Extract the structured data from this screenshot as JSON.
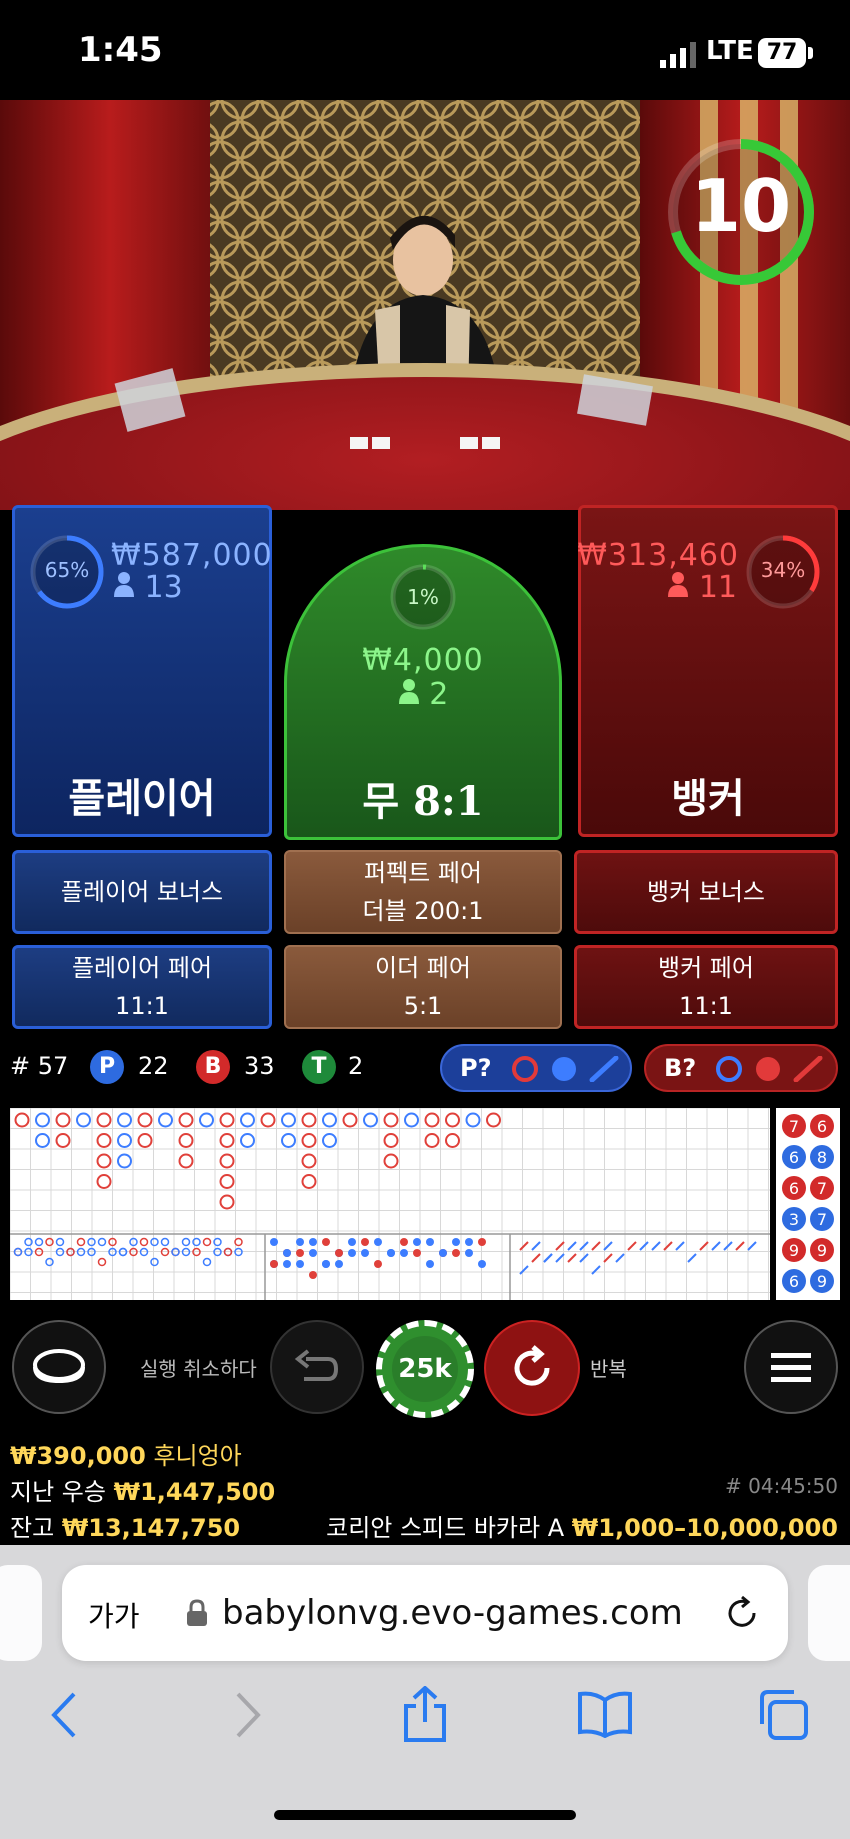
{
  "status_bar": {
    "time": "1:45",
    "network": "LTE",
    "battery": "77"
  },
  "video": {
    "timer": "10",
    "timer_color": "#37c837"
  },
  "player": {
    "percent": "65%",
    "amount": "₩587,000",
    "players": "13",
    "label": "플레이어",
    "color": "#2a5fd8"
  },
  "tie": {
    "percent": "1%",
    "amount": "₩4,000",
    "players": "2",
    "label": "무",
    "payout": "8:1",
    "color": "#3cc23a"
  },
  "banker": {
    "percent": "34%",
    "amount": "₩313,460",
    "players": "11",
    "label": "뱅커",
    "color": "#c02424"
  },
  "side_bets": {
    "player_bonus": "플레이어 보너스",
    "perfect_pair_line1": "퍼펙트 페어",
    "perfect_pair_line2": "더블 200:1",
    "banker_bonus": "뱅커 보너스",
    "player_pair_label": "플레이어 페어",
    "player_pair_payout": "11:1",
    "either_pair_label": "이더 페어",
    "either_pair_payout": "5:1",
    "banker_pair_label": "뱅커 페어",
    "banker_pair_payout": "11:1"
  },
  "stats": {
    "round": "# 57",
    "p_letter": "P",
    "p_count": "22",
    "b_letter": "B",
    "b_count": "33",
    "t_letter": "T",
    "t_count": "2",
    "p_predict": "P?",
    "b_predict": "B?"
  },
  "road_side": {
    "left": [
      "7",
      "6",
      "6",
      "3",
      "9",
      "6"
    ],
    "right": [
      "6",
      "8",
      "7",
      "7",
      "9",
      "9"
    ]
  },
  "controls": {
    "undo_label": "실행 취소하다",
    "chip_value": "25k",
    "repeat_label": "반복"
  },
  "footer": {
    "winner_amount": "₩390,000",
    "winner_name": "후니엉아",
    "last_win_label": "지난 우승",
    "last_win_amount": "₩1,447,500",
    "balance_label": "잔고",
    "balance_amount": "₩13,147,750",
    "round_id": "# 04:45:50",
    "table_name": "코리안 스피드 바카라 A",
    "limits": "₩1,000–10,000,000"
  },
  "browser": {
    "text_size": "가가",
    "url": "babylonvg.evo-games.com"
  }
}
